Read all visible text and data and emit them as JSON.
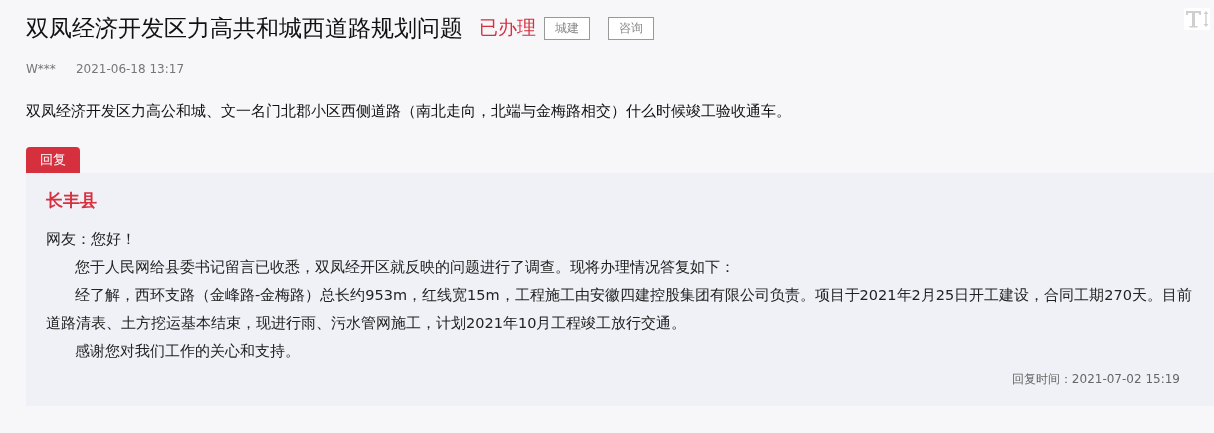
{
  "title": "双凤经济开发区力高共和城西道路规划问题",
  "status": "已办理",
  "tags": [
    "城建",
    "咨询"
  ],
  "author": "W***",
  "posted_time": "2021-06-18 13:17",
  "question": "双凤经济开发区力高公和城、文一名门北郡小区西侧道路（南北走向，北端与金梅路相交）什么时候竣工验收通车。",
  "reply": {
    "tab": "回复",
    "department": "长丰县",
    "greeting": "网友：您好！",
    "paragraphs": [
      "您于人民网给县委书记留言已收悉，双凤经开区就反映的问题进行了调查。现将办理情况答复如下：",
      "经了解，西环支路（金峰路-金梅路）总长约953m，红线宽15m，工程施工由安徽四建控股集团有限公司负责。项目于2021年2月25日开工建设，合同工期270天。目前道路清表、土方挖运基本结束，现进行雨、污水管网施工，计划2021年10月工程竣工放行交通。",
      "感谢您对我们工作的关心和支持。"
    ],
    "reply_time": "回复时间：2021-07-02 15:19"
  }
}
